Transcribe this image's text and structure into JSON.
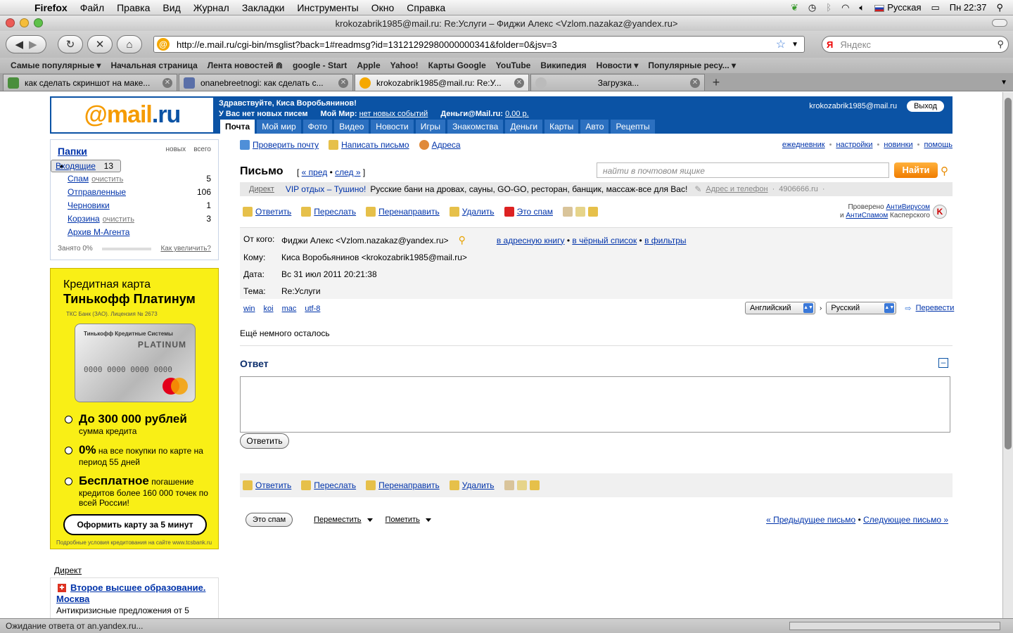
{
  "menubar": {
    "app": "Firefox",
    "items": [
      "Файл",
      "Правка",
      "Вид",
      "Журнал",
      "Закладки",
      "Инструменты",
      "Окно",
      "Справка"
    ],
    "input_lang": "Русская",
    "clock": "Пн 22:37"
  },
  "window": {
    "title": "krokozabrik1985@mail.ru: Re:Услуги – Фиджи Алекс <Vzlom.nazakaz@yandex.ru>"
  },
  "navbar": {
    "url": "http://e.mail.ru/cgi-bin/msglist?back=1#readmsg?id=13121292980000000341&folder=0&jsv=3",
    "search_placeholder": "Яндекс",
    "search_engine": "Я"
  },
  "bookmarks": [
    "Самые популярные ▾",
    "Начальная страница",
    "Лента новостей ⋒",
    "google - Start",
    "Apple",
    "Yahoo!",
    "Карты Google",
    "YouTube",
    "Википедия",
    "Новости ▾",
    "Популярные ресу... ▾"
  ],
  "tabs": [
    {
      "title": "как сделать скриншот на маке...",
      "fav_color": "#4a8e3c",
      "active": false
    },
    {
      "title": "onanebreetnogi: как сделать с...",
      "fav_color": "#5a6fa8",
      "active": false
    },
    {
      "title": "krokozabrik1985@mail.ru: Re:У...",
      "fav_color": "#f5a800",
      "active": true
    },
    {
      "title": "Загрузка...",
      "fav_color": "#bbbbbb",
      "active": false
    }
  ],
  "header": {
    "logo_at": "@",
    "logo_mail": "mail",
    "logo_ru": ".ru",
    "greeting": "Здравствуйте, Киса Воробьянинов!",
    "no_letters": "У Вас нет новых писем",
    "myworld_label": "Мой Мир:",
    "myworld_value": "нет новых событий",
    "money_label": "Деньги@Mail.ru:",
    "money_value": "0,00 р.",
    "user_email": "krokozabrik1985@mail.ru",
    "logout": "Выход",
    "services": [
      "Почта",
      "Мой мир",
      "Фото",
      "Видео",
      "Новости",
      "Игры",
      "Знакомства",
      "Деньги",
      "Карты",
      "Авто",
      "Рецепты"
    ]
  },
  "folders": {
    "title": "Папки",
    "col_new": "новых",
    "col_all": "всего",
    "items": [
      {
        "name": "Входящие",
        "sub": "",
        "count": "13",
        "selected": true
      },
      {
        "name": "Спам",
        "sub": "очистить",
        "count": "5",
        "selected": false
      },
      {
        "name": "Отправленные",
        "sub": "",
        "count": "106",
        "selected": false
      },
      {
        "name": "Черновики",
        "sub": "",
        "count": "1",
        "selected": false
      },
      {
        "name": "Корзина",
        "sub": "очистить",
        "count": "3",
        "selected": false
      },
      {
        "name": "Архив М-Агента",
        "sub": "",
        "count": "",
        "selected": false
      }
    ],
    "used": "Занято 0%",
    "how_increase": "Как увеличить?"
  },
  "ad": {
    "line1": "Кредитная карта",
    "line2": "Тинькофф Платинум",
    "license": "ТКС Банк (ЗАО). Лицензия № 2673",
    "card_bank": "Тинькофф Кредитные Системы",
    "card_tier": "PLATINUM",
    "card_number": "0000 0000 0000 0000",
    "b1_big": "До 300 000 рублей",
    "b1_small": "сумма кредита",
    "b2_big": "0%",
    "b2_small": "на все покупки по карте на период 55 дней",
    "b3_big": "Бесплатное",
    "b3_small": "погашение кредитов более 160 000 точек по всей России!",
    "cta": "Оформить карту за 5 минут",
    "fine": "Подробные условия кредитования на сайте www.tcsbank.ru"
  },
  "direkt": {
    "title": "Директ",
    "headline1": "Второе высшее образование.",
    "headline2": "Москва",
    "desc": "Антикризисные предложения от 5"
  },
  "toolbar": {
    "check": "Проверить почту",
    "write": "Написать письмо",
    "addresses": "Адреса",
    "right_links": [
      "ежедневник",
      "настройки",
      "новинки",
      "помощь"
    ]
  },
  "message": {
    "page_title": "Письмо",
    "prev": "« пред",
    "next": "след »",
    "search_placeholder": "найти в почтовом ящике",
    "find": "Найти",
    "ad_label": "Директ",
    "ad_title": "VIP отдых – Тушино!",
    "ad_text": "Русские бани на дровах, сауны, GO-GO, ресторан, банщик, массаж-все для Вас!",
    "ad_addr": "Адрес и телефон",
    "ad_site": "4906666.ru",
    "actions": {
      "reply": "Ответить",
      "forward": "Переслать",
      "redirect": "Перенаправить",
      "delete": "Удалить",
      "spam": "Это спам"
    },
    "av_checked": "Проверено",
    "av_antivirus": "АнтиВирусом",
    "av_and": "и",
    "av_antispam": "АнтиСпамом",
    "av_kaspersky": "Касперского",
    "from_label": "От кого:",
    "from_value": "Фиджи Алекс <Vzlom.nazakaz@yandex.ru>",
    "to_addressbook": "в адресную книгу",
    "to_blacklist": "в чёрный список",
    "to_filters": "в фильтры",
    "to_label": "Кому:",
    "to_value": "Киса Воробьянинов <krokozabrik1985@mail.ru>",
    "date_label": "Дата:",
    "date_value": "Вс 31 июл 2011 20:21:38",
    "subject_label": "Тема:",
    "subject_value": "Re:Услуги",
    "encodings": [
      "win",
      "koi",
      "mac",
      "utf-8"
    ],
    "lang_from": "Английский",
    "lang_to": "Русский",
    "translate": "Перевести",
    "body": "Ещё немного осталось",
    "reply_title": "Ответ",
    "reply_button": "Ответить",
    "spam_button": "Это спам",
    "move": "Переместить",
    "mark": "Пометить",
    "prev_letter": "« Предыдущее письмо",
    "next_letter": "Следующее письмо »"
  },
  "status": "Ожидание ответа от an.yandex.ru..."
}
